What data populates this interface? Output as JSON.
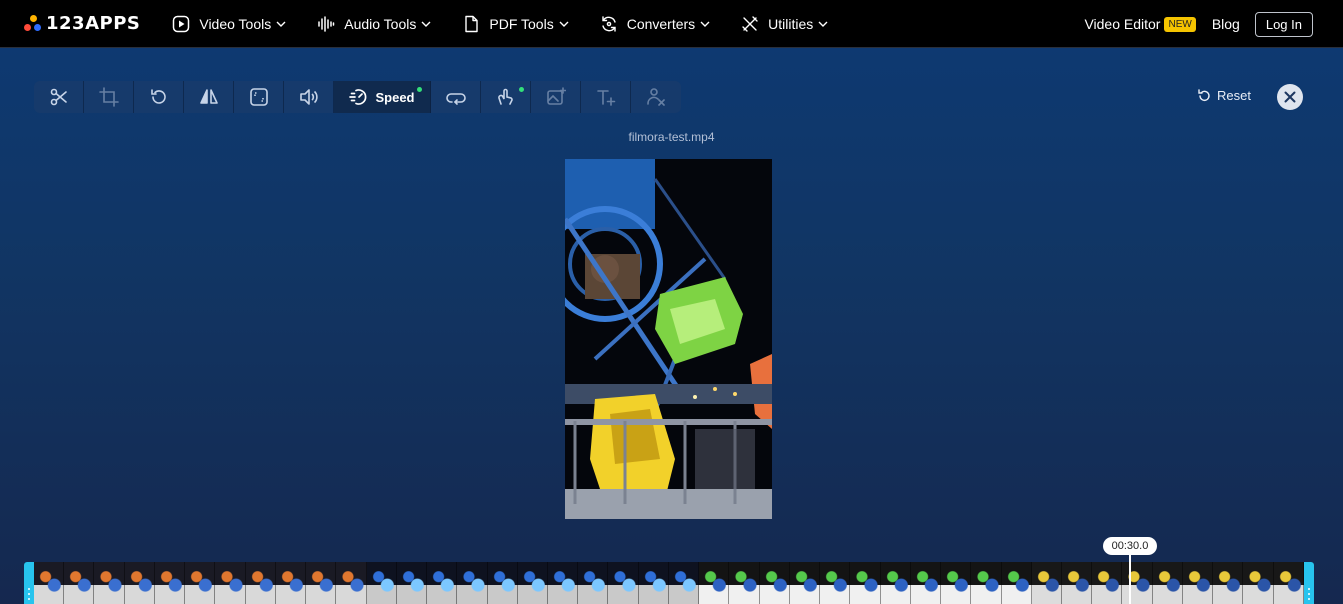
{
  "brand": {
    "logo_text": "123APPS"
  },
  "nav": {
    "items": [
      {
        "label": "Video Tools",
        "icon": "play-icon"
      },
      {
        "label": "Audio Tools",
        "icon": "waveform-icon"
      },
      {
        "label": "PDF Tools",
        "icon": "document-icon"
      },
      {
        "label": "Converters",
        "icon": "convert-icon"
      },
      {
        "label": "Utilities",
        "icon": "tools-icon"
      }
    ],
    "video_editor": "Video Editor",
    "new_badge": "NEW",
    "blog": "Blog",
    "login": "Log In"
  },
  "toolbar": {
    "tools": [
      {
        "name": "cut",
        "icon": "scissors-icon"
      },
      {
        "name": "crop",
        "icon": "crop-icon"
      },
      {
        "name": "rotate",
        "icon": "rotate-icon"
      },
      {
        "name": "flip",
        "icon": "flip-icon"
      },
      {
        "name": "resize",
        "icon": "resize-icon"
      },
      {
        "name": "volume",
        "icon": "volume-icon"
      },
      {
        "name": "speed",
        "icon": "speed-icon",
        "label": "Speed",
        "active": true
      },
      {
        "name": "loop",
        "icon": "loop-icon"
      },
      {
        "name": "stabilize",
        "icon": "stabilize-icon"
      },
      {
        "name": "add-image",
        "icon": "add-image-icon"
      },
      {
        "name": "add-text",
        "icon": "add-text-icon"
      },
      {
        "name": "remove-logo",
        "icon": "remove-logo-icon"
      }
    ],
    "reset_label": "Reset"
  },
  "editor": {
    "filename": "filmora-test.mp4",
    "timecode": "00:30.0"
  },
  "colors": {
    "accent": "#27c4ee",
    "badge": "#f5c400",
    "active_dot": "#33e07a"
  }
}
